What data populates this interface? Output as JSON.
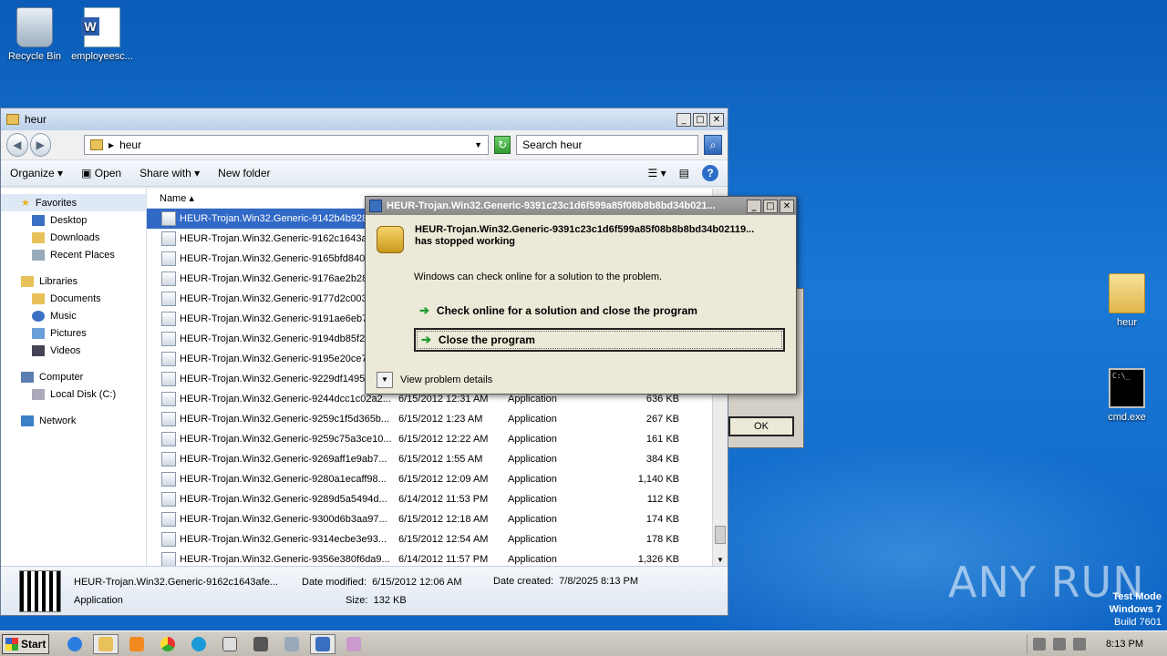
{
  "desktop": {
    "icons": [
      {
        "label": "Recycle Bin"
      },
      {
        "label": "employeesc..."
      },
      {
        "label": "heur"
      },
      {
        "label": "cmd.exe"
      }
    ],
    "watermark": "ANY RUN",
    "test_mode": {
      "line1": "Test Mode",
      "line2": "Windows 7",
      "line3": "Build 7601"
    }
  },
  "explorer": {
    "title": "heur",
    "address": "heur",
    "search_placeholder": "Search heur",
    "toolbar": {
      "organize": "Organize",
      "open": "Open",
      "share_with": "Share with",
      "new_folder": "New folder"
    },
    "nav": {
      "favorites": "Favorites",
      "fav_items": [
        "Desktop",
        "Downloads",
        "Recent Places"
      ],
      "libraries": "Libraries",
      "lib_items": [
        "Documents",
        "Music",
        "Pictures",
        "Videos"
      ],
      "computer": "Computer",
      "comp_items": [
        "Local Disk (C:)"
      ],
      "network": "Network"
    },
    "columns": {
      "name": "Name"
    },
    "rows": [
      {
        "name": "HEUR-Trojan.Win32.Generic-9142b4b928",
        "date": "",
        "type": "",
        "size": ""
      },
      {
        "name": "HEUR-Trojan.Win32.Generic-9162c1643a",
        "date": "",
        "type": "",
        "size": ""
      },
      {
        "name": "HEUR-Trojan.Win32.Generic-9165bfd840",
        "date": "",
        "type": "",
        "size": ""
      },
      {
        "name": "HEUR-Trojan.Win32.Generic-9176ae2b28",
        "date": "",
        "type": "",
        "size": ""
      },
      {
        "name": "HEUR-Trojan.Win32.Generic-9177d2c003",
        "date": "",
        "type": "",
        "size": ""
      },
      {
        "name": "HEUR-Trojan.Win32.Generic-9191ae6eb7",
        "date": "",
        "type": "",
        "size": ""
      },
      {
        "name": "HEUR-Trojan.Win32.Generic-9194db85f2",
        "date": "",
        "type": "",
        "size": ""
      },
      {
        "name": "HEUR-Trojan.Win32.Generic-9195e20ce7",
        "date": "",
        "type": "",
        "size": ""
      },
      {
        "name": "HEUR-Trojan.Win32.Generic-9229df1495",
        "date": "",
        "type": "",
        "size": ""
      },
      {
        "name": "HEUR-Trojan.Win32.Generic-9244dcc1c02a2...",
        "date": "6/15/2012 12:31 AM",
        "type": "Application",
        "size": "636 KB"
      },
      {
        "name": "HEUR-Trojan.Win32.Generic-9259c1f5d365b...",
        "date": "6/15/2012 1:23 AM",
        "type": "Application",
        "size": "267 KB"
      },
      {
        "name": "HEUR-Trojan.Win32.Generic-9259c75a3ce10...",
        "date": "6/15/2012 12:22 AM",
        "type": "Application",
        "size": "161 KB"
      },
      {
        "name": "HEUR-Trojan.Win32.Generic-9269aff1e9ab7...",
        "date": "6/15/2012 1:55 AM",
        "type": "Application",
        "size": "384 KB"
      },
      {
        "name": "HEUR-Trojan.Win32.Generic-9280a1ecaff98...",
        "date": "6/15/2012 12:09 AM",
        "type": "Application",
        "size": "1,140 KB"
      },
      {
        "name": "HEUR-Trojan.Win32.Generic-9289d5a5494d...",
        "date": "6/14/2012 11:53 PM",
        "type": "Application",
        "size": "112 KB"
      },
      {
        "name": "HEUR-Trojan.Win32.Generic-9300d6b3aa97...",
        "date": "6/15/2012 12:18 AM",
        "type": "Application",
        "size": "174 KB"
      },
      {
        "name": "HEUR-Trojan.Win32.Generic-9314ecbe3e93...",
        "date": "6/15/2012 12:54 AM",
        "type": "Application",
        "size": "178 KB"
      },
      {
        "name": "HEUR-Trojan.Win32.Generic-9356e380f6da9...",
        "date": "6/14/2012 11:57 PM",
        "type": "Application",
        "size": "1,326 KB"
      }
    ],
    "details": {
      "name": "HEUR-Trojan.Win32.Generic-9162c1643afe...",
      "type": "Application",
      "modified_label": "Date modified:",
      "modified": "6/15/2012 12:06 AM",
      "created_label": "Date created:",
      "created": "7/8/2025 8:13 PM",
      "size_label": "Size:",
      "size": "132 KB"
    }
  },
  "dialog": {
    "title": "HEUR-Trojan.Win32.Generic-9391c23c1d6f599a85f08b8b8bd34b021...",
    "message_line1": "HEUR-Trojan.Win32.Generic-9391c23c1d6f599a85f08b8b8bd34b02119...",
    "message_line2": "has stopped working",
    "sub": "Windows can check online for a solution to the problem.",
    "option1": "Check online for a solution and close the program",
    "option2": "Close the program",
    "details_link": "View problem details"
  },
  "behind_dialog": {
    "ok": "OK"
  },
  "taskbar": {
    "start": "Start",
    "clock": "8:13 PM"
  }
}
